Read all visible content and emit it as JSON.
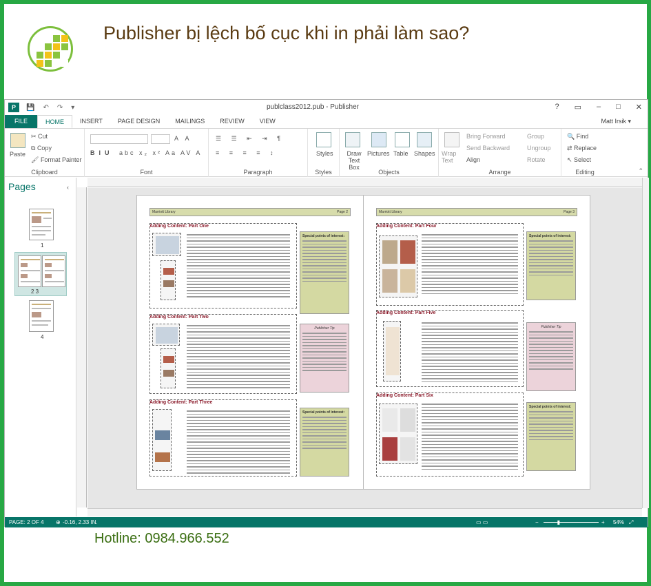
{
  "article": {
    "title": "Publisher bị lệch bố cục khi in phải làm sao?",
    "hotline": "Hotline: 0984.966.552"
  },
  "colors": {
    "frame": "#27a844",
    "accent": "#077568",
    "title": "#5a3b12",
    "hotline": "#3a6e12"
  },
  "app": {
    "logo_icon": "publisher-icon",
    "title": "publclass2012.pub - Publisher",
    "window_controls": [
      "?",
      "▭",
      "–",
      "□",
      "✕"
    ],
    "user": "Matt Irsik ▾",
    "tabs": [
      "FILE",
      "HOME",
      "INSERT",
      "PAGE DESIGN",
      "MAILINGS",
      "REVIEW",
      "VIEW"
    ],
    "active_tab": "HOME"
  },
  "ribbon": {
    "clipboard": {
      "paste": "Paste",
      "cut": "Cut",
      "copy": "Copy",
      "format_painter": "Format Painter",
      "label": "Clipboard"
    },
    "font": {
      "label": "Font"
    },
    "paragraph": {
      "label": "Paragraph"
    },
    "styles": {
      "button": "Styles",
      "label": "Styles"
    },
    "objects": {
      "draw_text_box": "Draw Text Box",
      "pictures": "Pictures",
      "table": "Table",
      "shapes": "Shapes",
      "label": "Objects"
    },
    "arrange": {
      "wrap_text": "Wrap Text",
      "bring_forward": "Bring Forward",
      "send_backward": "Send Backward",
      "align": "Align",
      "group": "Group",
      "ungroup": "Ungroup",
      "rotate": "Rotate",
      "label": "Arrange"
    },
    "editing": {
      "find": "Find",
      "replace": "Replace",
      "select": "Select",
      "label": "Editing"
    }
  },
  "pages_panel": {
    "title": "Pages",
    "thumbnails": [
      {
        "label": "1"
      },
      {
        "label": "2   3"
      },
      {
        "label": "4"
      }
    ]
  },
  "document": {
    "left_page": {
      "header_left": "Marriott Library",
      "header_right": "Page 2",
      "sections": [
        "Adding Content: Part One",
        "Adding Content: Part Two",
        "Adding Content: Part Three"
      ],
      "sidebars": [
        "Special points of interest:",
        "Publisher Tip",
        "Special points of interest:"
      ]
    },
    "right_page": {
      "header_left": "Marriott Library",
      "header_right": "Page 3",
      "sections": [
        "Adding Content: Part Four",
        "Adding Content: Part Five",
        "Adding Content: Part Six"
      ],
      "sidebars": [
        "Special points of interest:",
        "Publisher Tip",
        "Special points of interest:"
      ]
    }
  },
  "statusbar": {
    "page": "PAGE: 2 OF 4",
    "position": "-0.16, 2.33 IN.",
    "zoom": "54%",
    "zoom_level": 0.54
  }
}
